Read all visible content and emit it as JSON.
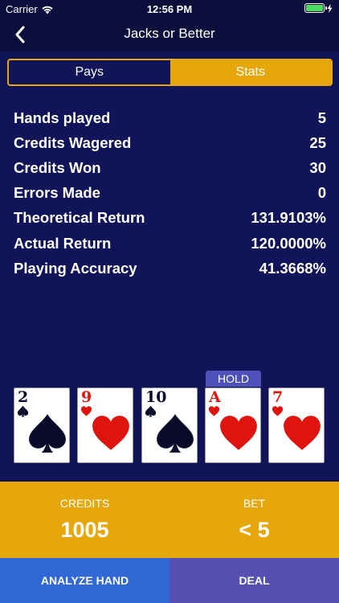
{
  "status": {
    "carrier": "Carrier",
    "time": "12:56 PM"
  },
  "nav": {
    "title": "Jacks or Better"
  },
  "tabs": [
    {
      "label": "Pays",
      "active": false
    },
    {
      "label": "Stats",
      "active": true
    }
  ],
  "stats": [
    {
      "label": "Hands played",
      "value": "5"
    },
    {
      "label": "Credits Wagered",
      "value": "25"
    },
    {
      "label": "Credits Won",
      "value": "30"
    },
    {
      "label": "Errors Made",
      "value": "0"
    },
    {
      "label": "Theoretical Return",
      "value": "131.9103%"
    },
    {
      "label": "Actual Return",
      "value": "120.0000%"
    },
    {
      "label": "Playing Accuracy",
      "value": "41.3668%"
    }
  ],
  "hold_label": "HOLD",
  "cards": [
    {
      "rank": "2",
      "suit": "spade",
      "held": false
    },
    {
      "rank": "9",
      "suit": "heart",
      "held": false
    },
    {
      "rank": "10",
      "suit": "spade",
      "held": false
    },
    {
      "rank": "A",
      "suit": "heart",
      "held": true
    },
    {
      "rank": "7",
      "suit": "heart",
      "held": false
    }
  ],
  "credits": {
    "label": "CREDITS",
    "value": "1005"
  },
  "bet": {
    "label": "BET",
    "value": "< 5"
  },
  "buttons": {
    "analyze": "ANALYZE HAND",
    "deal": "DEAL"
  },
  "colors": {
    "background": "#12145a",
    "accent": "#e6a70c",
    "analyze": "#3168d6",
    "deal": "#5550b2",
    "hold": "#4d51b8",
    "heart": "#e0140f",
    "spade": "#0a0a2a",
    "battery": "#4cd964"
  }
}
